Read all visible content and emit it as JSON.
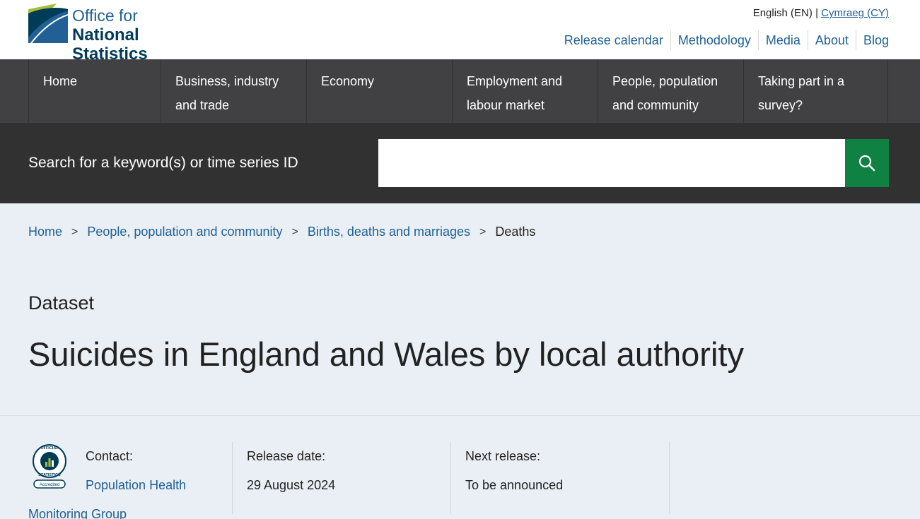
{
  "header": {
    "logo_line1": "Office for",
    "logo_line2": "National Statistics",
    "lang_current": "English (EN)",
    "lang_sep": "|",
    "lang_other": "Cymraeg (CY)",
    "links": [
      "Release calendar",
      "Methodology",
      "Media",
      "About",
      "Blog"
    ]
  },
  "nav": {
    "items": [
      {
        "line1": "Home",
        "line2": ""
      },
      {
        "line1": "Business, industry",
        "line2": "and trade"
      },
      {
        "line1": "Economy",
        "line2": ""
      },
      {
        "line1": "Employment and",
        "line2": "labour market"
      },
      {
        "line1": "People, population",
        "line2": "and community"
      },
      {
        "line1": "Taking part in a",
        "line2": "survey?"
      }
    ]
  },
  "search": {
    "label": "Search for a keyword(s) or time series ID",
    "value": "",
    "button_icon": "search-icon"
  },
  "breadcrumb": {
    "items": [
      "Home",
      "People, population and community",
      "Births, deaths and marriages"
    ],
    "separator": ">",
    "current": "Deaths"
  },
  "page": {
    "type": "Dataset",
    "title": "Suicides in England and Wales by local authority"
  },
  "meta": {
    "badge_icon": "official-statistics-accredited-badge",
    "badge_text_top": "OFFICIAL",
    "badge_text_bottom": "STATISTICS",
    "badge_label": "Accredited",
    "contact_label": "Contact:",
    "contact_line1": "Population Health",
    "contact_line2": "Monitoring Group",
    "release_label": "Release date:",
    "release_value": "29 August 2024",
    "next_label": "Next release:",
    "next_value": "To be announced"
  },
  "colors": {
    "brand_blue": "#206095",
    "brand_dark": "#003c57",
    "nav_bg": "#414042",
    "search_bg": "#323132",
    "search_button": "#0f8243",
    "hero_bg": "#e9eff4"
  }
}
